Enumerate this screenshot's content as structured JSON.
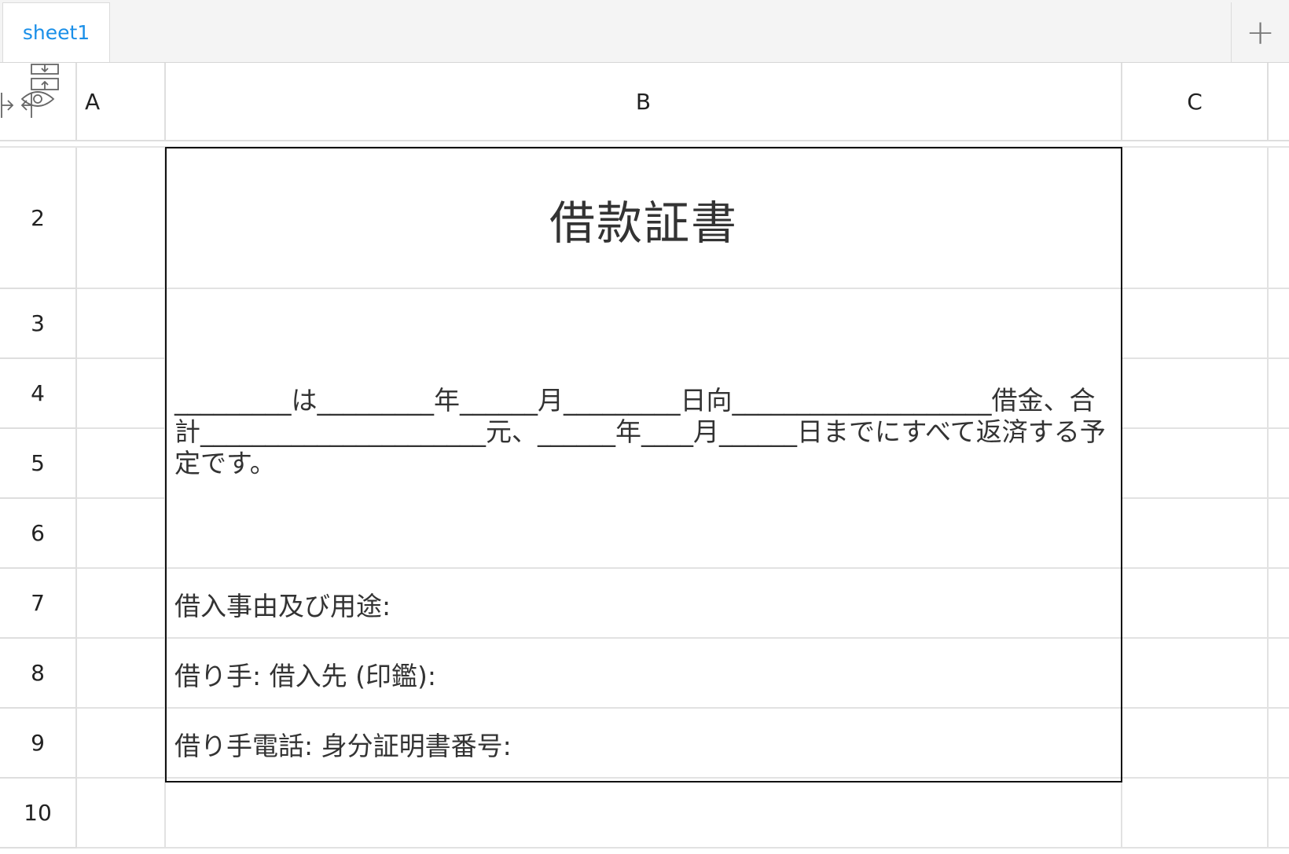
{
  "tabs": [
    {
      "label": "sheet1",
      "active": true
    }
  ],
  "add_sheet_label": "+",
  "columns": [
    "A",
    "B",
    "C"
  ],
  "rows": [
    "2",
    "3",
    "4",
    "5",
    "6",
    "7",
    "8",
    "9",
    "10"
  ],
  "document": {
    "title": "借款証書",
    "body": "_________は_________年______月_________日向____________________借金、合計______________________元、______年____月______日までにすべて返済する予定です。",
    "purpose_label": "借入事由及び用途:",
    "borrower_label": "借り手: 借入先 (印鑑):",
    "phone_label": "借り手電話: 身分証明書番号:"
  },
  "colors": {
    "tab_active": "#1a8fe8",
    "grid_line": "#e2e2e2",
    "border": "#111111"
  }
}
